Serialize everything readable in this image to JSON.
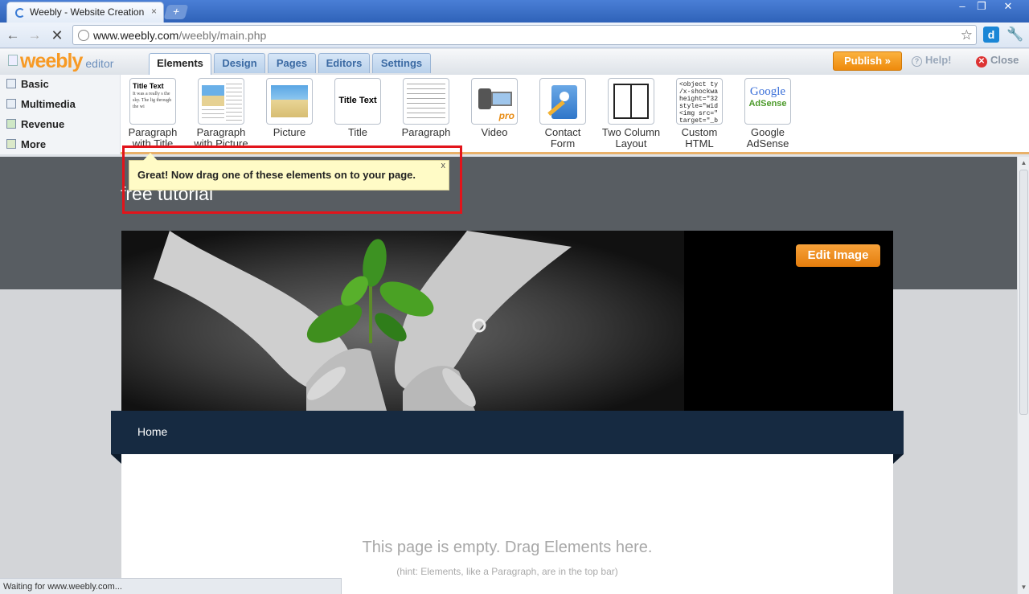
{
  "browser": {
    "tab_title": "Weebly - Website Creation Ma",
    "tab_close": "×",
    "new_tab": "+",
    "url_host": "www.weebly.com",
    "url_path": "/weebly/main.php",
    "window_controls": [
      "–",
      "❐",
      "✕"
    ]
  },
  "weebly": {
    "logo": "weebly",
    "logo_sub": "editor",
    "tabs": [
      "Elements",
      "Design",
      "Pages",
      "Editors",
      "Settings"
    ],
    "active_tab": "Elements",
    "publish": "Publish »",
    "help": "Help!",
    "close": "Close"
  },
  "categories": [
    "Basic",
    "Multimedia",
    "Revenue",
    "More"
  ],
  "elements": [
    {
      "line1": "Paragraph",
      "line2": "with Title",
      "icon": "paragraph-with-title-icon"
    },
    {
      "line1": "Paragraph",
      "line2": "with Picture",
      "icon": "paragraph-with-picture-icon"
    },
    {
      "line1": "Picture",
      "line2": "",
      "icon": "picture-icon"
    },
    {
      "line1": "Title",
      "line2": "",
      "icon": "title-icon"
    },
    {
      "line1": "Paragraph",
      "line2": "",
      "icon": "paragraph-icon"
    },
    {
      "line1": "Video",
      "line2": "",
      "icon": "video-icon"
    },
    {
      "line1": "Contact",
      "line2": "Form",
      "icon": "contact-form-icon"
    },
    {
      "line1": "Two Column",
      "line2": "Layout",
      "icon": "two-column-icon"
    },
    {
      "line1": "Custom",
      "line2": "HTML",
      "icon": "custom-html-icon"
    },
    {
      "line1": "Google",
      "line2": "AdSense",
      "icon": "adsense-icon"
    }
  ],
  "icon_text": {
    "title_text": "Title Text",
    "para_snippet": "It was a really s the sky. The lig through the wi",
    "html_snippet": "<object ty /x-shockwa height=\"32 style=\"wid <img src=\" target=\"_b",
    "google": "Google",
    "adsense": "AdSense",
    "pro": "pro"
  },
  "tooltip": {
    "text": "Great! Now drag one of these elements on to your page.",
    "close": "x"
  },
  "site": {
    "title": "free tutorial",
    "edit_image": "Edit Image",
    "nav_home": "Home",
    "empty_message": "This page is empty. Drag Elements here.",
    "hint": "(hint: Elements, like a Paragraph, are in the top bar)"
  },
  "status_bar": "Waiting for www.weebly.com...",
  "colors": {
    "accent_orange": "#f79a25",
    "highlight_red": "#e2141b",
    "nav_dark": "#162a41"
  }
}
